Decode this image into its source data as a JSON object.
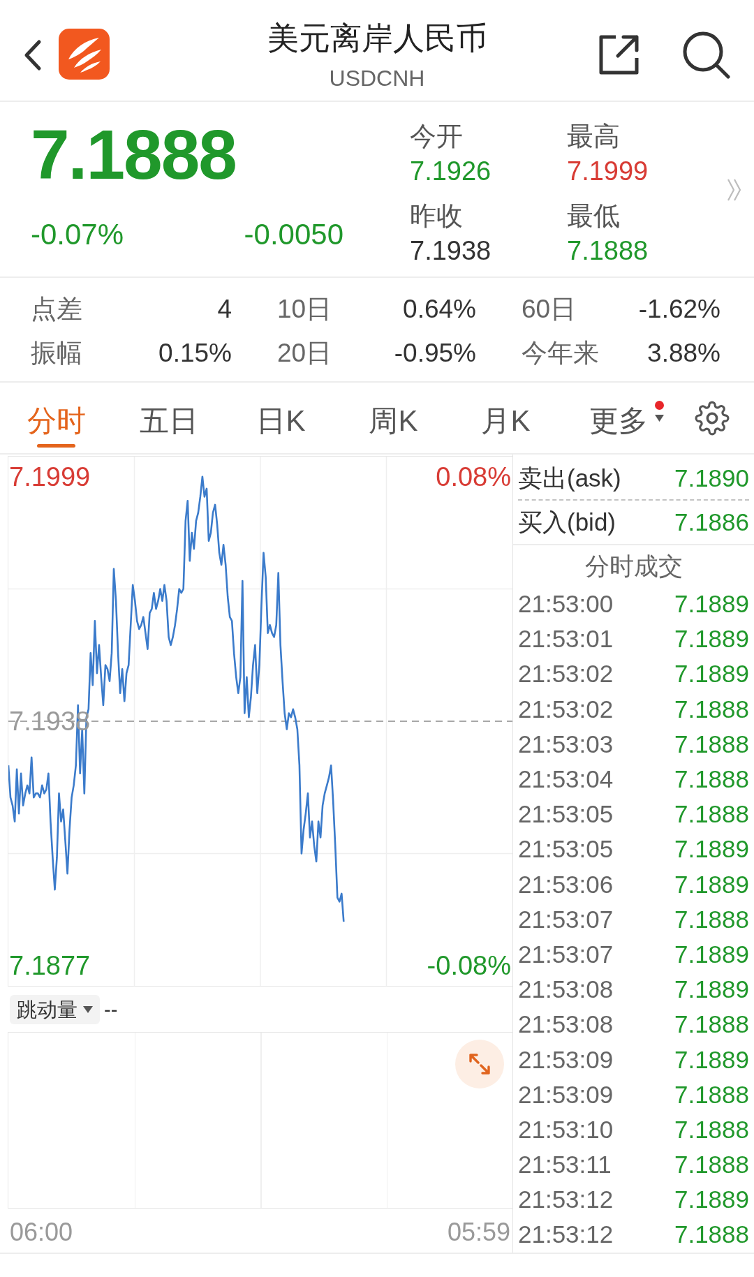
{
  "header": {
    "title": "美元离岸人民币",
    "symbol": "USDCNH"
  },
  "quote": {
    "price": "7.1888",
    "change_percent": "-0.07%",
    "change": "-0.0050",
    "color": "#20982b",
    "stats": [
      {
        "label": "今开",
        "value": "7.1926",
        "color": "#20982b"
      },
      {
        "label": "最高",
        "value": "7.1999",
        "color": "#d83c35"
      },
      {
        "label": "昨收",
        "value": "7.1938",
        "color": "#333333"
      },
      {
        "label": "最低",
        "value": "7.1888",
        "color": "#20982b"
      }
    ]
  },
  "metrics": [
    {
      "label": "点差",
      "value": "4"
    },
    {
      "label": "10日",
      "value": "0.64%"
    },
    {
      "label": "60日",
      "value": "-1.62%"
    },
    {
      "label": "振幅",
      "value": "0.15%"
    },
    {
      "label": "20日",
      "value": "-0.95%"
    },
    {
      "label": "今年来",
      "value": "3.88%"
    }
  ],
  "tabs": [
    {
      "label": "分时",
      "selected": true,
      "dropdown": false,
      "dot": false
    },
    {
      "label": "五日",
      "selected": false,
      "dropdown": false,
      "dot": false
    },
    {
      "label": "日K",
      "selected": false,
      "dropdown": false,
      "dot": false
    },
    {
      "label": "周K",
      "selected": false,
      "dropdown": false,
      "dot": false
    },
    {
      "label": "月K",
      "selected": false,
      "dropdown": false,
      "dot": false
    },
    {
      "label": "更多",
      "selected": false,
      "dropdown": true,
      "dot": true
    }
  ],
  "chart": {
    "percent_labels": [
      "0.08%",
      "-0.08%"
    ],
    "time_labels": [
      "06:00",
      "05:59"
    ],
    "chart_data": {
      "type": "line",
      "ylim": [
        7.1872,
        7.2004
      ],
      "yticks": [
        {
          "value": 7.1999,
          "label": "7.1999"
        },
        {
          "value": 7.1938,
          "label": "7.1938"
        },
        {
          "value": 7.1877,
          "label": "7.1877"
        }
      ],
      "categories": [
        null,
        null,
        null,
        null,
        null,
        null,
        null,
        null,
        null,
        null,
        null,
        null,
        null,
        null,
        null,
        null,
        null,
        null,
        null,
        null,
        null,
        null,
        null,
        null,
        null,
        null,
        null,
        null,
        null,
        null,
        null,
        null,
        null,
        null,
        null,
        null,
        null,
        null,
        null,
        null,
        null,
        null,
        null,
        null,
        null,
        null,
        null,
        null,
        null,
        null,
        null,
        null,
        null,
        null,
        null,
        null,
        null,
        null,
        null,
        null,
        null,
        null,
        null,
        null,
        null,
        null,
        null,
        null,
        null,
        null,
        null,
        null,
        null,
        null,
        null,
        null,
        null,
        null,
        null,
        null,
        null,
        null,
        null,
        null,
        null,
        null,
        null,
        null,
        null,
        null,
        null,
        null,
        null,
        null,
        null,
        null,
        null,
        null,
        null,
        null,
        null,
        null,
        null,
        null,
        null,
        null,
        null,
        null,
        null,
        null,
        null,
        null,
        null,
        null,
        null,
        null,
        null,
        null,
        null,
        null,
        null,
        null,
        null,
        null,
        null,
        null,
        null,
        null,
        null,
        null,
        null,
        null,
        null,
        null,
        null,
        null,
        null,
        null,
        null,
        null,
        null,
        null,
        null,
        null,
        null,
        null,
        null,
        null,
        null,
        null,
        null,
        null,
        null,
        null,
        null,
        null,
        null,
        null,
        null,
        null,
        null,
        null,
        null,
        null,
        null,
        null,
        null,
        null,
        null,
        null,
        null,
        null,
        null,
        null,
        null,
        null,
        null,
        null,
        null,
        null,
        null,
        null,
        null,
        null,
        null,
        null,
        null,
        null,
        null,
        null,
        null,
        null,
        null,
        null,
        null,
        null,
        null,
        null,
        null,
        null,
        null,
        null,
        null,
        null,
        null,
        null,
        null,
        null,
        null,
        null,
        null,
        null,
        null,
        null,
        null,
        null,
        null,
        null,
        null,
        null,
        null,
        null,
        null,
        null,
        null,
        null,
        null,
        null,
        null,
        null,
        null,
        null,
        null,
        null,
        null,
        null,
        null,
        null,
        null,
        null
      ],
      "series": [
        {
          "color": "#3b7bcb",
          "line_style": "solid",
          "values": [
            7.1927,
            7.1919,
            7.1917,
            7.1913,
            7.1926,
            7.1915,
            7.1925,
            7.1917,
            7.192,
            7.1922,
            7.192,
            7.1929,
            7.1919,
            7.192,
            7.192,
            7.1919,
            7.1922,
            7.192,
            7.1921,
            7.1925,
            7.1913,
            7.1904,
            7.1896,
            7.1904,
            7.192,
            7.1913,
            7.1916,
            7.1908,
            7.19,
            7.1911,
            7.1919,
            7.1922,
            7.1927,
            7.1942,
            7.1925,
            7.1936,
            7.192,
            7.1939,
            7.1941,
            7.1955,
            7.1947,
            7.1963,
            7.195,
            7.1957,
            7.1949,
            7.1942,
            7.1952,
            7.1951,
            7.1948,
            7.1955,
            7.1976,
            7.1968,
            7.1955,
            7.1945,
            7.1951,
            7.1943,
            7.195,
            7.1952,
            7.1962,
            7.1972,
            7.1968,
            7.1963,
            7.1961,
            7.1962,
            7.1964,
            7.196,
            7.1956,
            7.1965,
            7.1966,
            7.197,
            7.1966,
            7.1968,
            7.1971,
            7.1968,
            7.1972,
            7.1968,
            7.1959,
            7.1957,
            7.1959,
            7.1962,
            7.1966,
            7.1971,
            7.197,
            7.1971,
            7.1988,
            7.1993,
            7.1978,
            7.1985,
            7.1981,
            7.1988,
            7.199,
            7.1994,
            7.1999,
            7.1994,
            7.1996,
            7.1983,
            7.1985,
            7.199,
            7.1992,
            7.1987,
            7.198,
            7.1977,
            7.1982,
            7.1977,
            7.1969,
            7.1964,
            7.1963,
            7.1955,
            7.1949,
            7.1945,
            7.1949,
            7.1973,
            7.194,
            7.1949,
            7.1939,
            7.1944,
            7.1952,
            7.1957,
            7.1945,
            7.1952,
            7.1967,
            7.198,
            7.1974,
            7.196,
            7.1962,
            7.196,
            7.1959,
            7.1962,
            7.1975,
            7.1957,
            7.1948,
            7.194,
            7.1936,
            7.194,
            7.1939,
            7.1941,
            7.1939,
            7.1936,
            7.1927,
            7.1905,
            7.1911,
            7.1915,
            7.192,
            7.1909,
            7.1913,
            7.1907,
            7.1903,
            7.1913,
            7.1909,
            7.1917,
            7.192,
            7.1922,
            7.1924,
            7.1927,
            7.1918,
            7.1907,
            7.1894,
            7.1893,
            7.1895,
            7.1888,
            null,
            null,
            null,
            null,
            null,
            null,
            null,
            null,
            null,
            null,
            null,
            null,
            null,
            null,
            null,
            null,
            null,
            null,
            null,
            null,
            null,
            null,
            null,
            null,
            null,
            null,
            null,
            null,
            null,
            null,
            null,
            null,
            null,
            null,
            null,
            null,
            null,
            null,
            null,
            null,
            null,
            null,
            null,
            null,
            null,
            null,
            null,
            null,
            null,
            null,
            null,
            null,
            null,
            null,
            null,
            null,
            null,
            null,
            null,
            null,
            null,
            null,
            null,
            null,
            null,
            null,
            null,
            null,
            null,
            null,
            null,
            null,
            null,
            null,
            null,
            null,
            null,
            null,
            null,
            null
          ]
        },
        {
          "color": "#a8a8a8",
          "line_style": "dashed",
          "values": [
            7.1938,
            7.1938,
            7.1938,
            7.1938,
            7.1938,
            7.1938,
            7.1938,
            7.1938,
            7.1938,
            7.1938,
            7.1938,
            7.1938,
            7.1938,
            7.1938,
            7.1938,
            7.1938,
            7.1938,
            7.1938,
            7.1938,
            7.1938,
            7.1938,
            7.1938,
            7.1938,
            7.1938,
            7.1938,
            7.1938,
            7.1938,
            7.1938,
            7.1938,
            7.1938,
            7.1938,
            7.1938,
            7.1938,
            7.1938,
            7.1938,
            7.1938,
            7.1938,
            7.1938,
            7.1938,
            7.1938,
            7.1938,
            7.1938,
            7.1938,
            7.1938,
            7.1938,
            7.1938,
            7.1938,
            7.1938,
            7.1938,
            7.1938,
            7.1938,
            7.1938,
            7.1938,
            7.1938,
            7.1938,
            7.1938,
            7.1938,
            7.1938,
            7.1938,
            7.1938,
            7.1938,
            7.1938,
            7.1938,
            7.1938,
            7.1938,
            7.1938,
            7.1938,
            7.1938,
            7.1938,
            7.1938,
            7.1938,
            7.1938,
            7.1938,
            7.1938,
            7.1938,
            7.1938,
            7.1938,
            7.1938,
            7.1938,
            7.1938,
            7.1938,
            7.1938,
            7.1938,
            7.1938,
            7.1938,
            7.1938,
            7.1938,
            7.1938,
            7.1938,
            7.1938,
            7.1938,
            7.1938,
            7.1938,
            7.1938,
            7.1938,
            7.1938,
            7.1938,
            7.1938,
            7.1938,
            7.1938,
            7.1938,
            7.1938,
            7.1938,
            7.1938,
            7.1938,
            7.1938,
            7.1938,
            7.1938,
            7.1938,
            7.1938,
            7.1938,
            7.1938,
            7.1938,
            7.1938,
            7.1938,
            7.1938,
            7.1938,
            7.1938,
            7.1938,
            7.1938,
            7.1938,
            7.1938,
            7.1938,
            7.1938,
            7.1938,
            7.1938,
            7.1938,
            7.1938,
            7.1938,
            7.1938,
            7.1938,
            7.1938,
            7.1938,
            7.1938,
            7.1938,
            7.1938,
            7.1938,
            7.1938,
            7.1938,
            7.1938,
            7.1938,
            7.1938,
            7.1938,
            7.1938,
            7.1938,
            7.1938,
            7.1938,
            7.1938,
            7.1938,
            7.1938,
            7.1938,
            7.1938,
            7.1938,
            7.1938,
            7.1938,
            7.1938,
            7.1938,
            7.1938,
            7.1938,
            7.1938,
            7.1938,
            7.1938,
            7.1938,
            7.1938,
            7.1938,
            7.1938,
            7.1938,
            7.1938,
            7.1938,
            7.1938,
            7.1938,
            7.1938,
            7.1938,
            7.1938,
            7.1938,
            7.1938,
            7.1938,
            7.1938,
            7.1938,
            7.1938,
            7.1938,
            7.1938,
            7.1938,
            7.1938,
            7.1938,
            7.1938,
            7.1938,
            7.1938,
            7.1938,
            7.1938,
            7.1938,
            7.1938,
            7.1938,
            7.1938,
            7.1938,
            7.1938,
            7.1938,
            7.1938,
            7.1938,
            7.1938,
            7.1938,
            7.1938,
            7.1938,
            7.1938,
            7.1938,
            7.1938,
            7.1938,
            7.1938,
            7.1938,
            7.1938,
            7.1938,
            7.1938,
            7.1938,
            7.1938,
            7.1938,
            7.1938,
            7.1938,
            7.1938,
            7.1938,
            7.1938,
            7.1938,
            7.1938,
            7.1938,
            7.1938,
            7.1938,
            7.1938,
            7.1938,
            7.1938,
            7.1938,
            7.1938,
            7.1938,
            7.1938,
            7.1938,
            7.1938,
            7.1938,
            7.1938,
            7.1938,
            7.1938,
            7.1938,
            7.1938
          ]
        }
      ]
    }
  },
  "volume": {
    "selector": "跳动量",
    "value": "--"
  },
  "order_book": [
    {
      "label": "卖出(ask)",
      "value": "7.1890",
      "color": "#20982b"
    },
    {
      "label": "买入(bid)",
      "value": "7.1886",
      "color": "#20982b"
    }
  ],
  "trades": {
    "title": "分时成交",
    "rows": [
      {
        "time": "21:53:00",
        "price": "7.1889",
        "color": "#20982b"
      },
      {
        "time": "21:53:01",
        "price": "7.1889",
        "color": "#20982b"
      },
      {
        "time": "21:53:02",
        "price": "7.1889",
        "color": "#20982b"
      },
      {
        "time": "21:53:02",
        "price": "7.1888",
        "color": "#20982b"
      },
      {
        "time": "21:53:03",
        "price": "7.1888",
        "color": "#20982b"
      },
      {
        "time": "21:53:04",
        "price": "7.1888",
        "color": "#20982b"
      },
      {
        "time": "21:53:05",
        "price": "7.1888",
        "color": "#20982b"
      },
      {
        "time": "21:53:05",
        "price": "7.1889",
        "color": "#20982b"
      },
      {
        "time": "21:53:06",
        "price": "7.1889",
        "color": "#20982b"
      },
      {
        "time": "21:53:07",
        "price": "7.1888",
        "color": "#20982b"
      },
      {
        "time": "21:53:07",
        "price": "7.1889",
        "color": "#20982b"
      },
      {
        "time": "21:53:08",
        "price": "7.1889",
        "color": "#20982b"
      },
      {
        "time": "21:53:08",
        "price": "7.1888",
        "color": "#20982b"
      },
      {
        "time": "21:53:09",
        "price": "7.1889",
        "color": "#20982b"
      },
      {
        "time": "21:53:09",
        "price": "7.1888",
        "color": "#20982b"
      },
      {
        "time": "21:53:10",
        "price": "7.1888",
        "color": "#20982b"
      },
      {
        "time": "21:53:11",
        "price": "7.1888",
        "color": "#20982b"
      },
      {
        "time": "21:53:12",
        "price": "7.1889",
        "color": "#20982b"
      },
      {
        "time": "21:53:12",
        "price": "7.1888",
        "color": "#20982b"
      }
    ]
  }
}
